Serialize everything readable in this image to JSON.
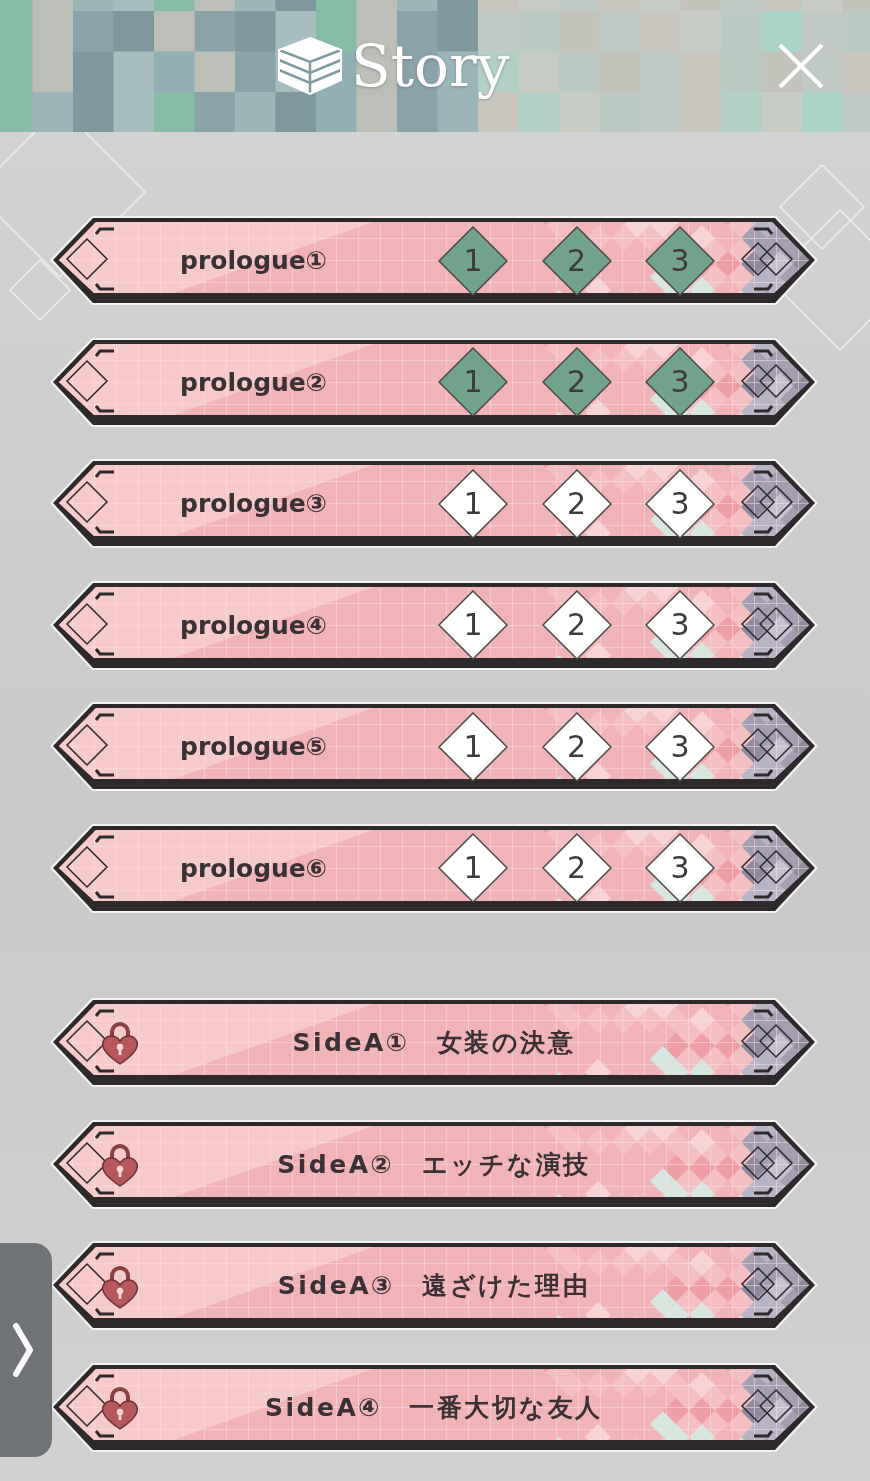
{
  "header": {
    "title": "Story"
  },
  "chapter_groups": [
    {
      "chapters": [
        {
          "title": "prologue①",
          "locked": false,
          "episodes": [
            {
              "label": "1",
              "completed": true
            },
            {
              "label": "2",
              "completed": true
            },
            {
              "label": "3",
              "completed": true
            }
          ]
        },
        {
          "title": "prologue②",
          "locked": false,
          "episodes": [
            {
              "label": "1",
              "completed": true
            },
            {
              "label": "2",
              "completed": true
            },
            {
              "label": "3",
              "completed": true
            }
          ]
        },
        {
          "title": "prologue③",
          "locked": false,
          "episodes": [
            {
              "label": "1",
              "completed": false
            },
            {
              "label": "2",
              "completed": false
            },
            {
              "label": "3",
              "completed": false
            }
          ]
        },
        {
          "title": "prologue④",
          "locked": false,
          "episodes": [
            {
              "label": "1",
              "completed": false
            },
            {
              "label": "2",
              "completed": false
            },
            {
              "label": "3",
              "completed": false
            }
          ]
        },
        {
          "title": "prologue⑤",
          "locked": false,
          "episodes": [
            {
              "label": "1",
              "completed": false
            },
            {
              "label": "2",
              "completed": false
            },
            {
              "label": "3",
              "completed": false
            }
          ]
        },
        {
          "title": "prologue⑥",
          "locked": false,
          "episodes": [
            {
              "label": "1",
              "completed": false
            },
            {
              "label": "2",
              "completed": false
            },
            {
              "label": "3",
              "completed": false
            }
          ]
        }
      ]
    },
    {
      "chapters": [
        {
          "title": "SideA①　女装の決意",
          "locked": true
        },
        {
          "title": "SideA②　エッチな演技",
          "locked": true
        },
        {
          "title": "SideA③　遠ざけた理由",
          "locked": true
        },
        {
          "title": "SideA④　一番大切な友人",
          "locked": true
        }
      ]
    }
  ]
}
